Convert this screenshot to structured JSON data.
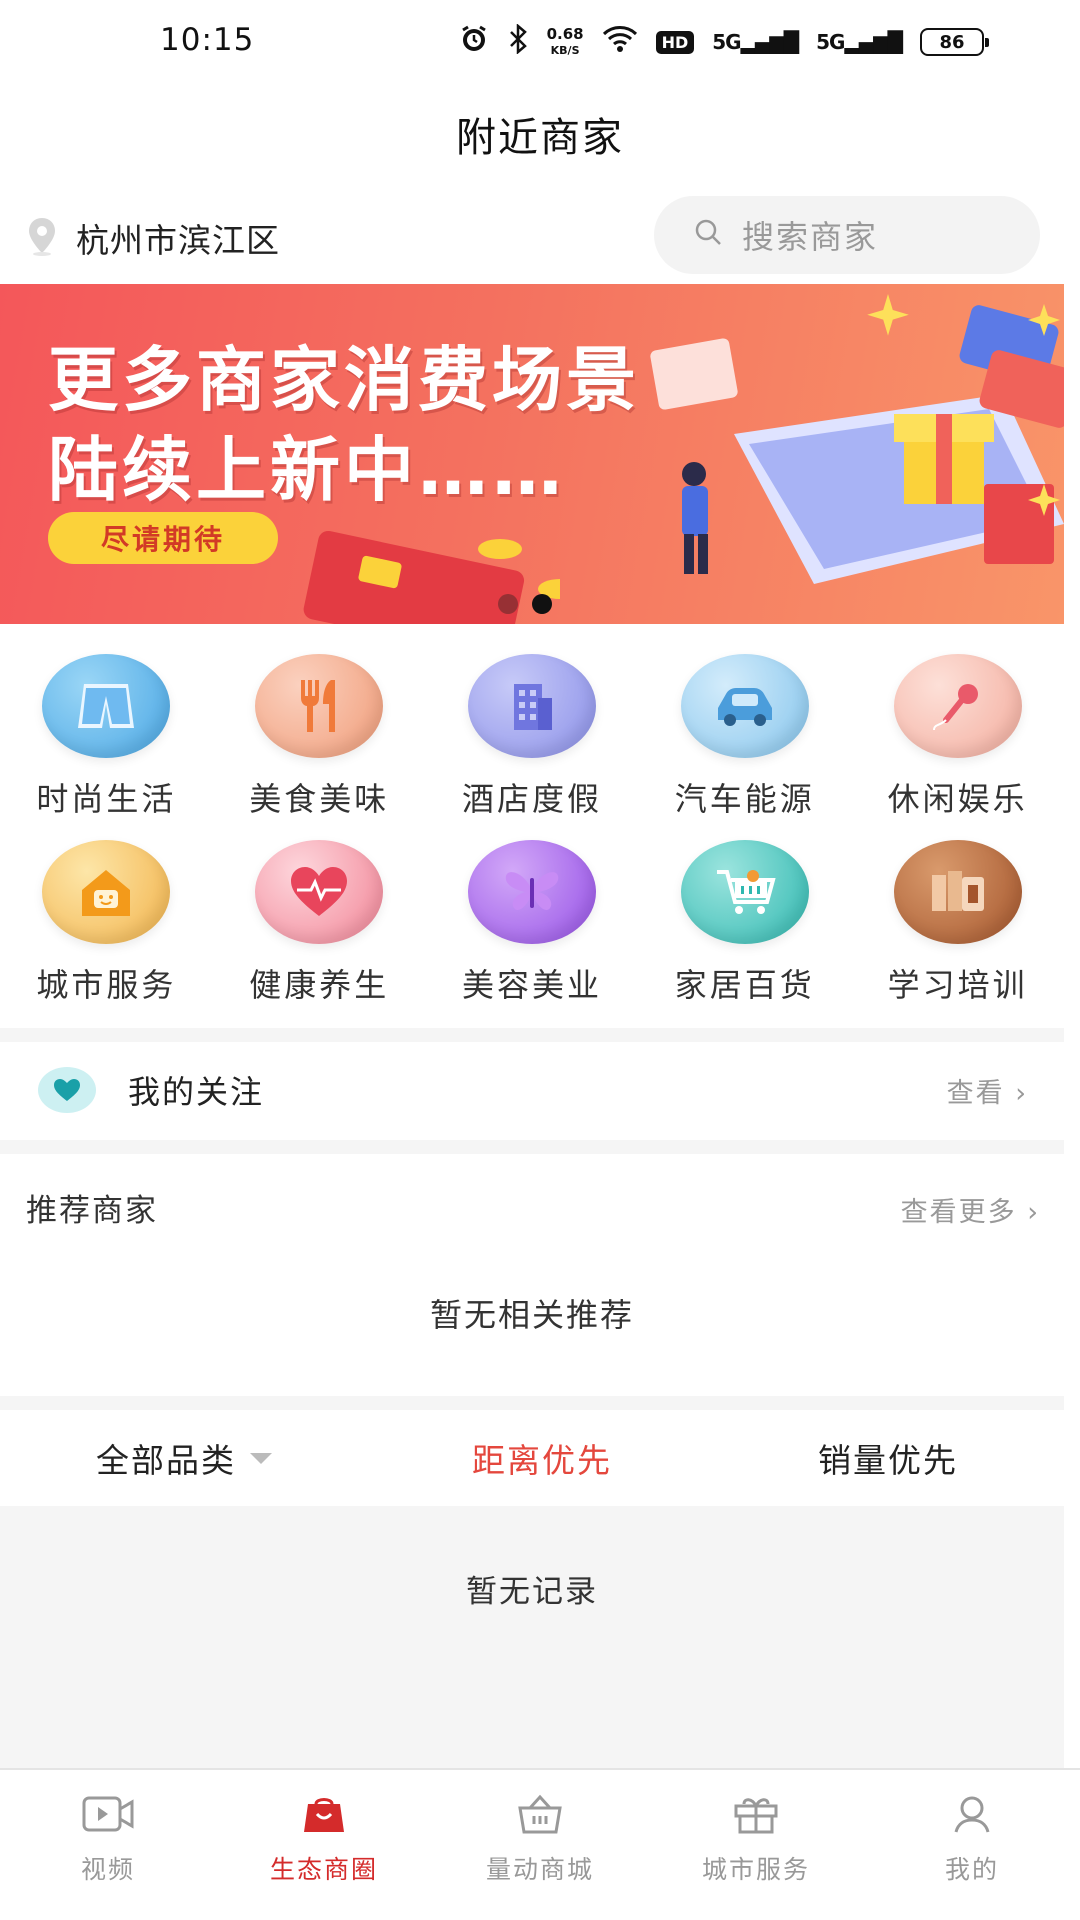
{
  "status_bar": {
    "time": "10:15",
    "net_speed": "0.68",
    "net_unit": "KB/S",
    "hd": "HD",
    "signal1": "5G",
    "signal2": "5G",
    "battery": "86"
  },
  "header": {
    "title": "附近商家"
  },
  "location": {
    "city": "杭州市滨江区",
    "icon": "location-pin-icon"
  },
  "search": {
    "placeholder": "搜索商家",
    "icon": "search-icon"
  },
  "banner": {
    "line1": "更多商家消费场景",
    "line2": "陆续上新中……",
    "button": "尽请期待",
    "colors": {
      "start": "#f4575a",
      "end": "#f99569",
      "button": "#fbd23a"
    }
  },
  "categories": [
    {
      "label": "时尚生活",
      "icon": "clothing-icon",
      "color": "#5fb6ea"
    },
    {
      "label": "美食美味",
      "icon": "fork-knife-icon",
      "color": "#f4a07a"
    },
    {
      "label": "酒店度假",
      "icon": "building-icon",
      "color": "#8f93ea"
    },
    {
      "label": "汽车能源",
      "icon": "car-icon",
      "color": "#8cc9ee"
    },
    {
      "label": "休闲娱乐",
      "icon": "microphone-icon",
      "color": "#f5b1a4"
    },
    {
      "label": "城市服务",
      "icon": "house-icon",
      "color": "#f4b74b"
    },
    {
      "label": "健康养生",
      "icon": "heart-pulse-icon",
      "color": "#f27f90"
    },
    {
      "label": "美容美业",
      "icon": "butterfly-icon",
      "color": "#a063ec"
    },
    {
      "label": "家居百货",
      "icon": "cart-icon",
      "color": "#36c3bc"
    },
    {
      "label": "学习培训",
      "icon": "books-icon",
      "color": "#b5653b"
    }
  ],
  "follow": {
    "label": "我的关注",
    "link": "查看"
  },
  "recommend": {
    "title": "推荐商家",
    "more": "查看更多",
    "empty": "暂无相关推荐"
  },
  "filters": {
    "all": "全部品类",
    "distance": "距离优先",
    "sales": "销量优先"
  },
  "list": {
    "empty": "暂无记录"
  },
  "bottom_nav": [
    {
      "label": "视频",
      "icon": "video-icon"
    },
    {
      "label": "生态商圈",
      "icon": "shop-bag-icon",
      "active": true
    },
    {
      "label": "量动商城",
      "icon": "basket-icon"
    },
    {
      "label": "城市服务",
      "icon": "gift-icon"
    },
    {
      "label": "我的",
      "icon": "user-icon"
    }
  ],
  "accent_color": "#e4473d"
}
